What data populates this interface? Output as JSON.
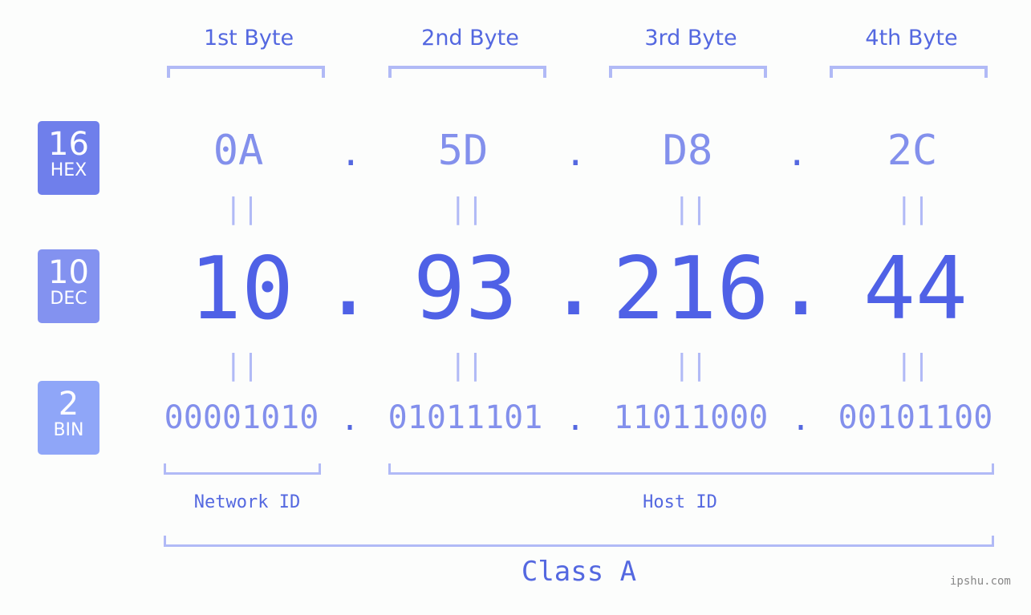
{
  "bytes": [
    {
      "label": "1st Byte",
      "hex": "0A",
      "dec": "10",
      "bin": "00001010"
    },
    {
      "label": "2nd Byte",
      "hex": "5D",
      "dec": "93",
      "bin": "01011101"
    },
    {
      "label": "3rd Byte",
      "hex": "D8",
      "dec": "216",
      "bin": "11011000"
    },
    {
      "label": "4th Byte",
      "hex": "2C",
      "dec": "44",
      "bin": "00101100"
    }
  ],
  "badges": {
    "hex": {
      "num": "16",
      "label": "HEX",
      "color": "#6f7feb"
    },
    "dec": {
      "num": "10",
      "label": "DEC",
      "color": "#8392f0"
    },
    "bin": {
      "num": "2",
      "label": "BIN",
      "color": "#8fa6f8"
    }
  },
  "separator": ".",
  "equals": "||",
  "network_id": "Network ID",
  "host_id": "Host ID",
  "class_label": "Class A",
  "watermark": "ipshu.com"
}
